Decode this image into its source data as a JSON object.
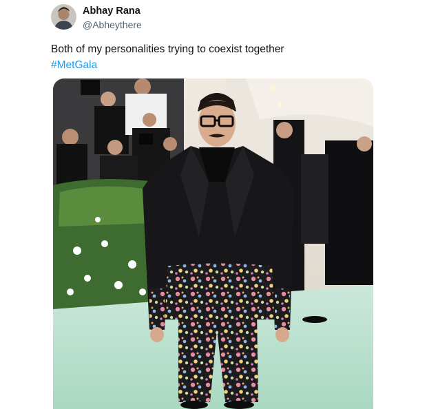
{
  "tweet": {
    "display_name": "Abhay Rana",
    "handle": "@Abheythere",
    "text": "Both of my personalities trying to coexist together",
    "hashtag": "#MetGala"
  },
  "media": {
    "kind": "photo",
    "alt": "Man in black blazer with floral-embroidered hem and floral trousers on a green carpet"
  },
  "colors": {
    "text": "#0f1419",
    "secondary": "#536471",
    "link": "#1d9bf0",
    "carpet": "#b8e0cc"
  },
  "icons": {
    "avatar": "avatar-photo"
  }
}
